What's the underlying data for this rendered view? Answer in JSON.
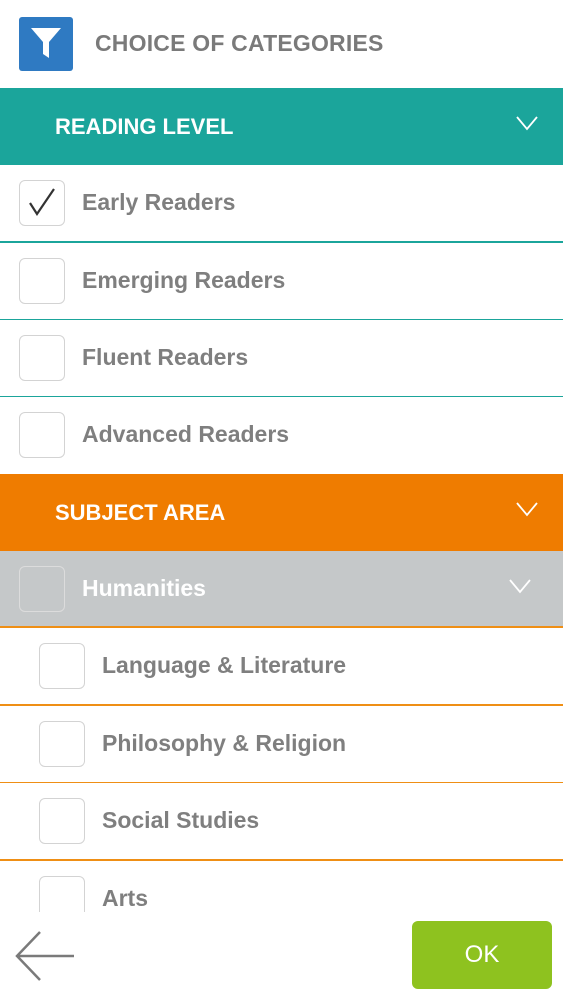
{
  "header": {
    "title": "CHOICE OF CATEGORIES",
    "icon": "filter-icon"
  },
  "reading_level": {
    "label": "READING LEVEL",
    "color": "#1ba59b",
    "items": [
      {
        "label": "Early Readers",
        "checked": true
      },
      {
        "label": "Emerging Readers",
        "checked": false
      },
      {
        "label": "Fluent Readers",
        "checked": false
      },
      {
        "label": "Advanced Readers",
        "checked": false
      }
    ]
  },
  "subject_area": {
    "label": "SUBJECT AREA",
    "color": "#ef7c00",
    "group": {
      "label": "Humanities",
      "checked": false
    },
    "items": [
      {
        "label": "Language & Literature",
        "checked": false
      },
      {
        "label": "Philosophy & Religion",
        "checked": false
      },
      {
        "label": "Social Studies",
        "checked": false
      },
      {
        "label": "Arts",
        "checked": false
      }
    ]
  },
  "footer": {
    "ok_label": "OK",
    "ok_color": "#8ec21f",
    "back_icon": "back-arrow-icon"
  }
}
